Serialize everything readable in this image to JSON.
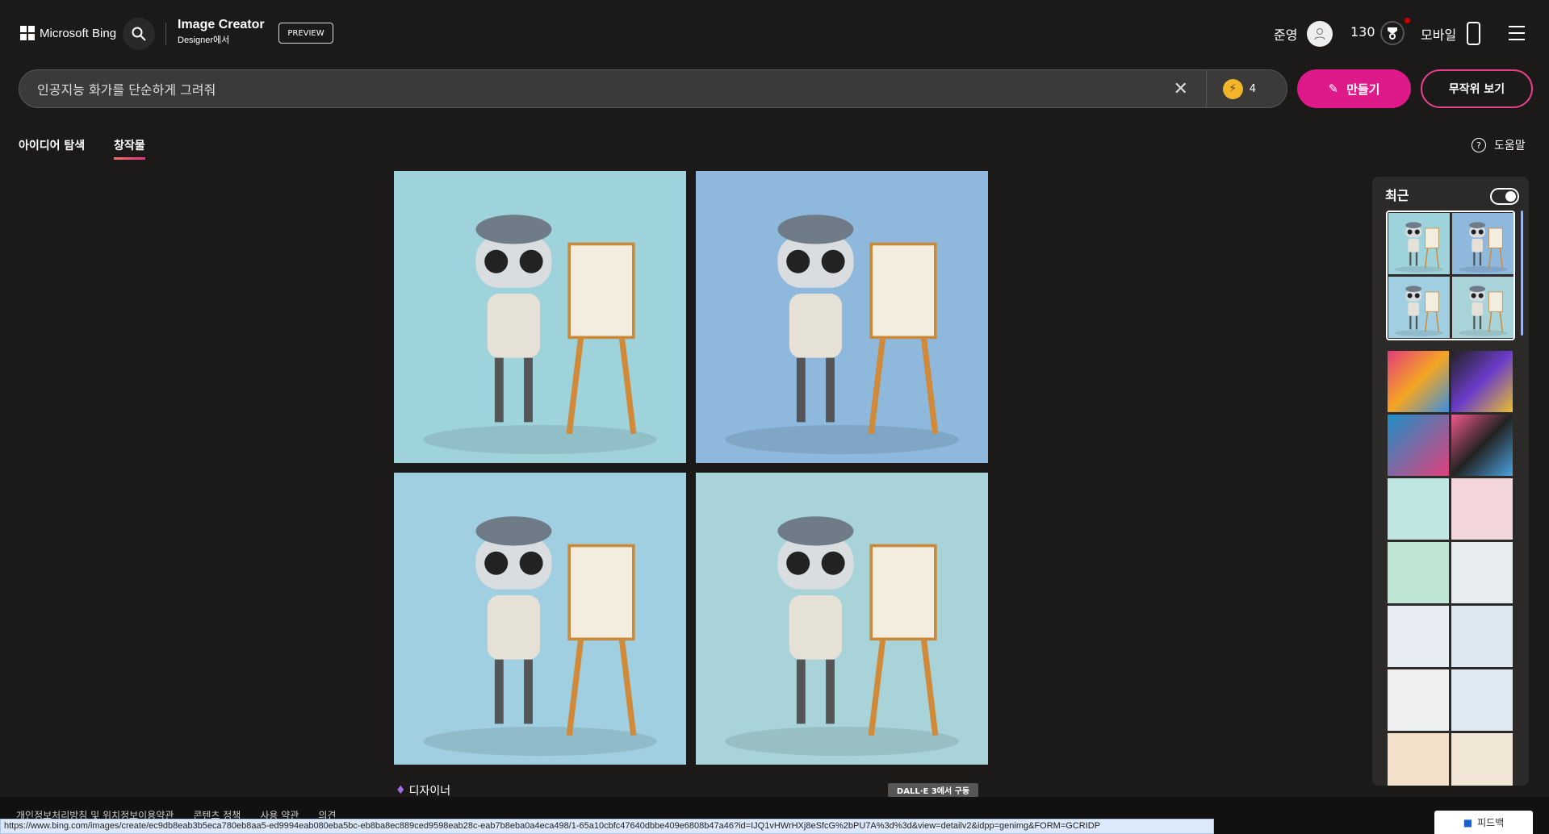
{
  "header": {
    "brand": "Microsoft Bing",
    "app_title": "Image Creator",
    "app_subtitle": "Designer에서",
    "preview": "PREVIEW",
    "user_name": "준영",
    "points": "130",
    "mobile": "모바일"
  },
  "search": {
    "value": "인공지능 화가를 단순하게 그려줘",
    "boost_count": "4",
    "make_label": "만들기",
    "random_label": "무작위 보기"
  },
  "tabs": [
    {
      "label": "아이디어 탐색",
      "active": false
    },
    {
      "label": "창작물",
      "active": true
    }
  ],
  "help_label": "도움말",
  "results": {
    "designer_label": "디자이너",
    "badge": "DALL·E 3에서 구동",
    "images": [
      "robot-painter-1",
      "robot-painter-2",
      "robot-painter-3",
      "robot-painter-4"
    ]
  },
  "sidebar": {
    "title": "최근",
    "toggle_on": true
  },
  "footer": {
    "links": [
      "개인정보처리방침 및 위치정보이용약관",
      "콘텐츠 정책",
      "사용 약관",
      "의견"
    ],
    "feedback": "피드백"
  },
  "status_url": "https://www.bing.com/images/create/ec9db8eab3b5eca780eb8aa5-ed9994eab080eba5bc-eb8ba8ec889ced9598eab28c-eab7b8eba0a4eca498/1-65a10cbfc47640dbbe409e6808b47a46?id=IJQ1vHWrHXj8eSfcG%2bPU7A%3d%3d&view=detailv2&idpp=genimg&FORM=GCRIDP",
  "colors": {
    "accent": "#de1a8a",
    "background": "#1b1a19",
    "coin": "#f1b52b"
  }
}
